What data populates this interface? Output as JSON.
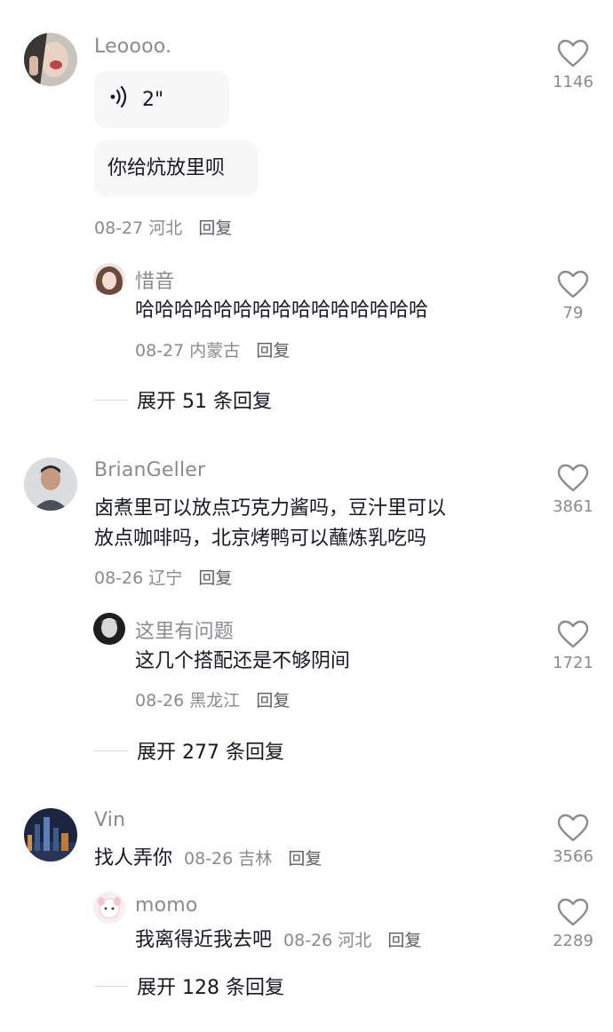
{
  "comments": [
    {
      "username": "Leoooo.",
      "voice_duration": "2\"",
      "text": "你给炕放里呗",
      "date": "08-27",
      "location": "河北",
      "reply_label": "回复",
      "likes": "1146",
      "replies": [
        {
          "username": "惜音",
          "text": "哈哈哈哈哈哈哈哈哈哈哈哈哈哈哈",
          "date": "08-27",
          "location": "内蒙古",
          "reply_label": "回复",
          "likes": "79"
        }
      ],
      "expand_label": "展开 51 条回复"
    },
    {
      "username": "BrianGeller",
      "text_line1": "卤煮里可以放点巧克力酱吗，豆汁里可以",
      "text_line2": "放点咖啡吗，北京烤鸭可以蘸炼乳吃吗",
      "date": "08-26",
      "location": "辽宁",
      "reply_label": "回复",
      "likes": "3861",
      "replies": [
        {
          "username": "这里有问题",
          "text": "这几个搭配还是不够阴间",
          "date": "08-26",
          "location": "黑龙江",
          "reply_label": "回复",
          "likes": "1721"
        }
      ],
      "expand_label": "展开 277 条回复"
    },
    {
      "username": "Vin",
      "text": "找人弄你",
      "date": "08-26",
      "location": "吉林",
      "reply_label": "回复",
      "likes": "3566",
      "replies": [
        {
          "username": "momo",
          "text": "我离得近我去吧",
          "date": "08-26",
          "location": "河北",
          "reply_label": "回复",
          "likes": "2289"
        }
      ],
      "expand_label": "展开 128 条回复"
    }
  ],
  "icons": {
    "like": "heart-outline-icon",
    "voice": "voice-wave-icon"
  },
  "colors": {
    "text": "#161823",
    "secondary": "#8a8a8f",
    "bubble": "#f7f7f8"
  }
}
